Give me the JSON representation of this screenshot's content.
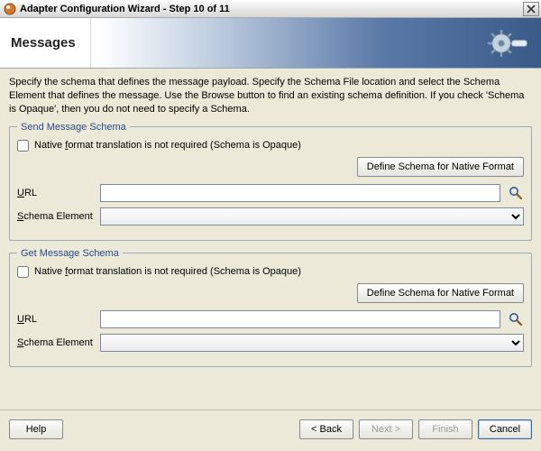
{
  "window": {
    "title": "Adapter Configuration Wizard - Step 10 of 11"
  },
  "header": {
    "title": "Messages"
  },
  "intro": "Specify the schema that defines the message payload.  Specify the Schema File location and select the Schema Element that defines the message. Use the Browse button to find an existing schema definition. If you check 'Schema is Opaque', then you do not need to specify a Schema.",
  "send": {
    "legend": "Send Message Schema",
    "opaque_label_pre": "Native ",
    "opaque_label_u": "f",
    "opaque_label_post": "ormat translation is not required (Schema is Opaque)",
    "opaque_checked": false,
    "define_btn": "Define Schema for Native Format",
    "url_label_u": "U",
    "url_label_post": "RL",
    "url_value": "",
    "schema_label_u": "S",
    "schema_label_post": "chema Element",
    "schema_value": ""
  },
  "get": {
    "legend": "Get Message Schema",
    "opaque_label_pre": "Native ",
    "opaque_label_u": "f",
    "opaque_label_post": "ormat translation is not required (Schema is Opaque)",
    "opaque_checked": false,
    "define_btn": "Define Schema for Native Format",
    "url_label_u": "U",
    "url_label_post": "RL",
    "url_value": "",
    "schema_label_u": "S",
    "schema_label_post": "chema Element",
    "schema_value": ""
  },
  "footer": {
    "help": "Help",
    "back": "< Back",
    "next": "Next >",
    "finish": "Finish",
    "cancel": "Cancel"
  }
}
